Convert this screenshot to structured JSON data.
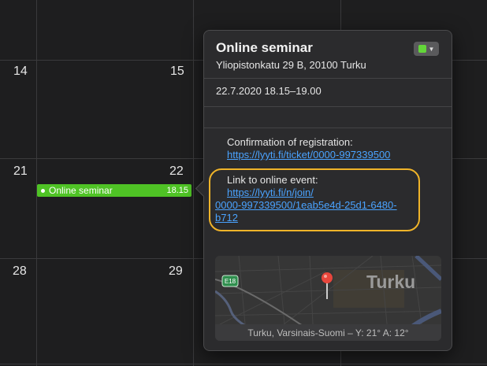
{
  "calendar": {
    "days": {
      "d14": "14",
      "d15": "15",
      "d21": "21",
      "d22": "22",
      "d28": "28",
      "d29": "29"
    },
    "event": {
      "title": "Online seminar",
      "time": "18.15"
    }
  },
  "popover": {
    "title": "Online seminar",
    "address": "Yliopistonkatu 29 B, 20100 Turku",
    "datetime": "22.7.2020 18.15–19.00",
    "color": "#63d639",
    "notes": {
      "confirmation_label": "Confirmation of registration:",
      "confirmation_link": "https://lyyti.fi/ticket/0000-997339500",
      "online_label": "Link to online event:",
      "online_link_line1": "https://lyyti.fi/n/join/",
      "online_link_line2": "0000-997339500/1eab5e4d-25d1-6480-",
      "online_link_line3": "b712"
    },
    "map": {
      "city_label": "Turku",
      "road_badge": "E18",
      "footer": "Turku, Varsinais-Suomi – Y: 21° A: 12°"
    }
  }
}
